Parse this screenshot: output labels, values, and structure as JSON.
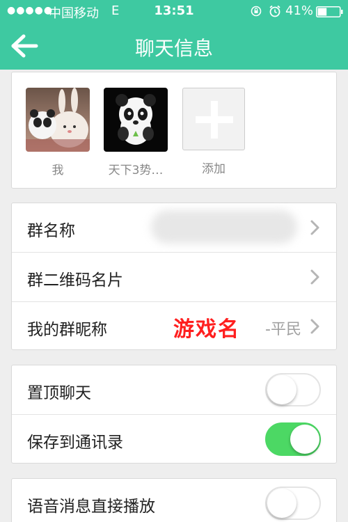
{
  "status_bar": {
    "signal": "●●●●●",
    "carrier": "中国移动",
    "network": "E",
    "time": "13:51",
    "battery": "41%",
    "battery_level": 0.41
  },
  "nav": {
    "title": "聊天信息",
    "back_icon": "arrow-left-icon"
  },
  "members": [
    {
      "name": "我"
    },
    {
      "name": "天下3势…"
    },
    {
      "name": "添加"
    }
  ],
  "group_settings": {
    "name_label": "群名称",
    "qrcode_label": "群二维码名片",
    "nickname_label": "我的群昵称",
    "nickname_value": "-平民",
    "overlay": "游戏名"
  },
  "toggles": [
    {
      "label": "置顶聊天",
      "on": false
    },
    {
      "label": "保存到通讯录",
      "on": true
    },
    {
      "label": "语音消息直接播放",
      "on": false
    }
  ],
  "colors": {
    "header": "#3ec9a1",
    "toggle_on": "#4cd864",
    "background": "#eeeeee"
  }
}
